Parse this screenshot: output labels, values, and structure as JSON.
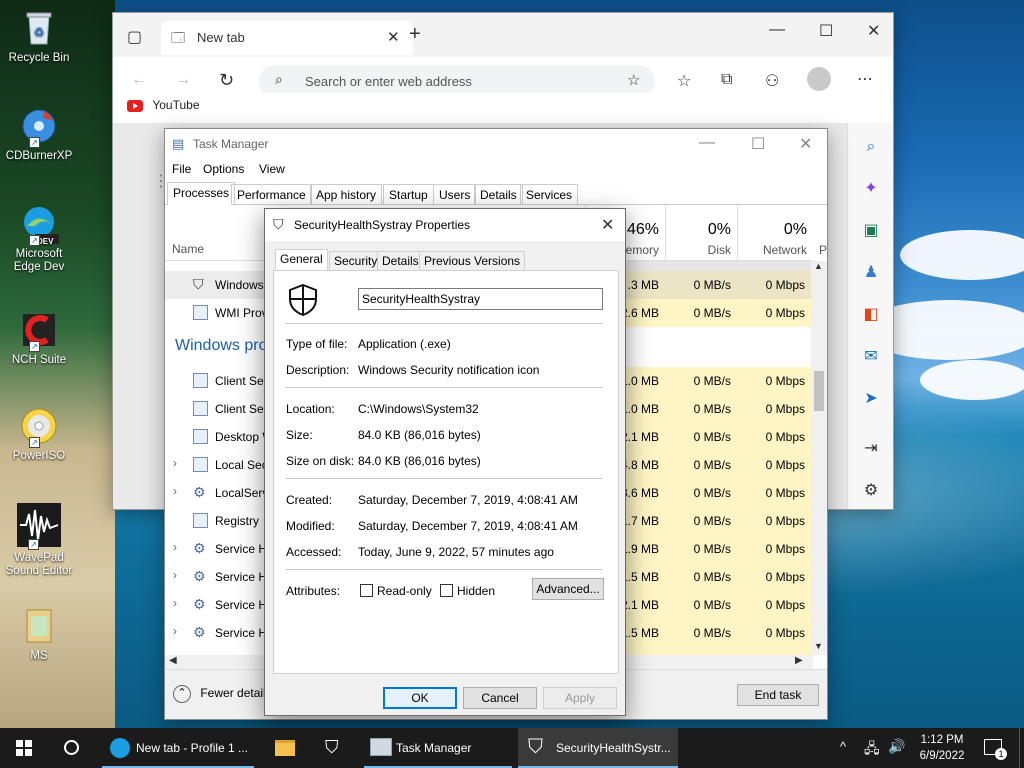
{
  "desktop": {
    "icons": [
      {
        "label": "Recycle Bin",
        "name": "recycle-bin-icon"
      },
      {
        "label": "CDBurnerXP",
        "name": "cdburnerxp-icon"
      },
      {
        "label": "Microsoft Edge Dev",
        "name": "edge-dev-icon",
        "badge": "DEV"
      },
      {
        "label": "NCH Suite",
        "name": "nch-suite-icon"
      },
      {
        "label": "PowerISO",
        "name": "poweriso-icon"
      },
      {
        "label": "WavePad Sound Editor",
        "name": "wavepad-icon"
      },
      {
        "label": "MS",
        "name": "ms-folder-icon"
      }
    ]
  },
  "edge": {
    "tab_title": "New tab",
    "address_placeholder": "Search or enter web address",
    "favorites": [
      {
        "label": "YouTube"
      }
    ]
  },
  "task_manager": {
    "title": "Task Manager",
    "menu": [
      "File",
      "Options",
      "View"
    ],
    "tabs": [
      "Processes",
      "Performance",
      "App history",
      "Startup",
      "Users",
      "Details",
      "Services"
    ],
    "columns": {
      "name": "Name",
      "memory_pct": "46%",
      "memory": "emory",
      "disk_pct": "0%",
      "disk": "Disk",
      "network_pct": "0%",
      "network": "Network",
      "power": "P"
    },
    "group_header": "Windows pro",
    "rows": [
      {
        "name": "Windows",
        "mem": ".3 MB",
        "disk": "0 MB/s",
        "net": "0 Mbps",
        "expand": false,
        "icon": "shield-icon"
      },
      {
        "name": "WMI Provi",
        "mem": "2.6 MB",
        "disk": "0 MB/s",
        "net": "0 Mbps",
        "expand": false,
        "icon": "process-icon"
      },
      {
        "name": "Client Ser",
        "mem": "1.0 MB",
        "disk": "0 MB/s",
        "net": "0 Mbps",
        "expand": false,
        "icon": "process-icon"
      },
      {
        "name": "Client Ser",
        "mem": "1.0 MB",
        "disk": "0 MB/s",
        "net": "0 Mbps",
        "expand": false,
        "icon": "process-icon"
      },
      {
        "name": "Desktop W",
        "mem": "2.1 MB",
        "disk": "0 MB/s",
        "net": "0 Mbps",
        "expand": false,
        "icon": "process-icon"
      },
      {
        "name": "Local Sec",
        "mem": "4.8 MB",
        "disk": "0 MB/s",
        "net": "0 Mbps",
        "expand": true,
        "icon": "process-icon"
      },
      {
        "name": "LocalServ",
        "mem": "3.6 MB",
        "disk": "0 MB/s",
        "net": "0 Mbps",
        "expand": true,
        "icon": "gear-icon"
      },
      {
        "name": "Registry",
        "mem": "1.7 MB",
        "disk": "0 MB/s",
        "net": "0 Mbps",
        "expand": false,
        "icon": "process-icon"
      },
      {
        "name": "Service H",
        "mem": "1.9 MB",
        "disk": "0 MB/s",
        "net": "0 Mbps",
        "expand": true,
        "icon": "gear-icon"
      },
      {
        "name": "Service H",
        "mem": "1.5 MB",
        "disk": "0 MB/s",
        "net": "0 Mbps",
        "expand": true,
        "icon": "gear-icon"
      },
      {
        "name": "Service H",
        "mem": "2.1 MB",
        "disk": "0 MB/s",
        "net": "0 Mbps",
        "expand": true,
        "icon": "gear-icon"
      },
      {
        "name": "Service H",
        "mem": "1.5 MB",
        "disk": "0 MB/s",
        "net": "0 Mbps",
        "expand": true,
        "icon": "gear-icon"
      }
    ],
    "fewer_details": "Fewer details",
    "end_task": "End task"
  },
  "properties": {
    "title": "SecurityHealthSystray Properties",
    "tabs": [
      "General",
      "Security",
      "Details",
      "Previous Versions"
    ],
    "file_name": "SecurityHealthSystray",
    "fields": {
      "type_label": "Type of file:",
      "type_value": "Application (.exe)",
      "desc_label": "Description:",
      "desc_value": "Windows Security notification icon",
      "location_label": "Location:",
      "location_value": "C:\\Windows\\System32",
      "size_label": "Size:",
      "size_value": "84.0 KB (86,016 bytes)",
      "size_disk_label": "Size on disk:",
      "size_disk_value": "84.0 KB (86,016 bytes)",
      "created_label": "Created:",
      "created_value": "Saturday, December 7, 2019, 4:08:41 AM",
      "modified_label": "Modified:",
      "modified_value": "Saturday, December 7, 2019, 4:08:41 AM",
      "accessed_label": "Accessed:",
      "accessed_value": "Today, June 9, 2022, 57 minutes ago",
      "attributes_label": "Attributes:",
      "readonly_label": "Read-only",
      "hidden_label": "Hidden",
      "advanced_label": "Advanced..."
    },
    "buttons": {
      "ok": "OK",
      "cancel": "Cancel",
      "apply": "Apply"
    }
  },
  "taskbar": {
    "items": [
      {
        "label": "New tab - Profile 1 ...",
        "name": "taskbar-edge"
      },
      {
        "label": "Task Manager",
        "name": "taskbar-task-manager"
      },
      {
        "label": "SecurityHealthSystr...",
        "name": "taskbar-properties"
      }
    ],
    "time": "1:12 PM",
    "date": "6/9/2022",
    "notifications": "1",
    "colors": {
      "accent": "#76b9ed",
      "taskbar": "#1b1b1b"
    }
  }
}
